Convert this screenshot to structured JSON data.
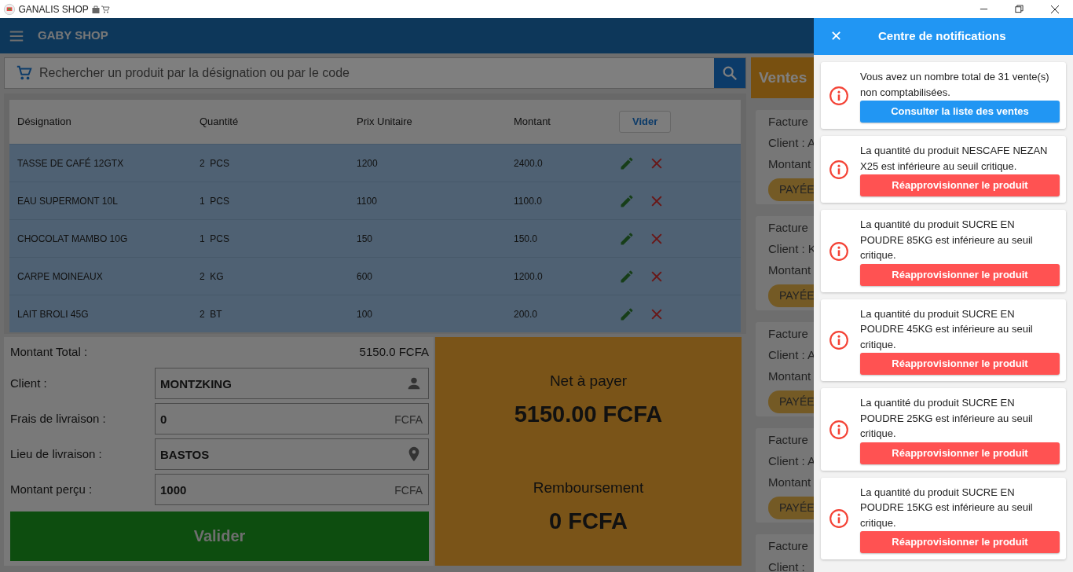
{
  "window": {
    "title": "GANALIS SHOP"
  },
  "app_bar": {
    "title": "GABY SHOP"
  },
  "search": {
    "placeholder": "Rechercher un produit par la désignation ou par le code"
  },
  "cart": {
    "columns": [
      "Désignation",
      "Quantité",
      "Prix Unitaire",
      "Montant"
    ],
    "clear_button": "Vider",
    "rows": [
      {
        "designation": "TASSE DE CAFÉ 12GTX",
        "quantity": "2",
        "unit": "PCS",
        "unit_price": "1200",
        "amount": "2400.0"
      },
      {
        "designation": "EAU SUPERMONT 10L",
        "quantity": "1",
        "unit": "PCS",
        "unit_price": "1100",
        "amount": "1100.0"
      },
      {
        "designation": "CHOCOLAT MAMBO 10G",
        "quantity": "1",
        "unit": "PCS",
        "unit_price": "150",
        "amount": "150.0"
      },
      {
        "designation": "CARPE MOINEAUX",
        "quantity": "2",
        "unit": "KG",
        "unit_price": "600",
        "amount": "1200.0"
      },
      {
        "designation": "LAIT BROLI 45G",
        "quantity": "2",
        "unit": "BT",
        "unit_price": "100",
        "amount": "200.0"
      }
    ]
  },
  "checkout": {
    "total_label": "Montant Total :",
    "total_value": "5150.0 FCFA",
    "fields": [
      {
        "kind": "person",
        "label": "Client :",
        "value": "MONTZKING"
      },
      {
        "kind": "currency",
        "label": "Frais de livraison :",
        "value": "0",
        "suffix": "FCFA"
      },
      {
        "kind": "place",
        "label": "Lieu de livraison :",
        "value": "BASTOS"
      },
      {
        "kind": "currency",
        "label": "Montant perçu :",
        "value": "1000",
        "suffix": "FCFA"
      }
    ],
    "submit_button": "Valider"
  },
  "payment": {
    "net_label": "Net à payer",
    "net_value": "5150.00 FCFA",
    "refund_label": "Remboursement",
    "refund_value": "0 FCFA"
  },
  "recent_sales": {
    "title": "Ventes",
    "cards": [
      {
        "invoice": "Facture",
        "client": "Client : A",
        "amount": "Montant",
        "status": "PAYÉE"
      },
      {
        "invoice": "Facture",
        "client": "Client : K",
        "amount": "Montant",
        "status": "PAYÉE"
      },
      {
        "invoice": "Facture",
        "client": "Client : A",
        "amount": "Montant",
        "status": "PAYÉE"
      },
      {
        "invoice": "Facture",
        "client": "Client : A",
        "amount": "Montant",
        "status": "PAYÉE"
      },
      {
        "invoice": "Facture",
        "client": "Client :"
      }
    ]
  },
  "notifications": {
    "title": "Centre de notifications",
    "close": "✕",
    "items": [
      {
        "kind": "sales",
        "message": "Vous avez un nombre total de 31 vente(s) non comptabilisées.",
        "action": "Consulter la liste des ventes"
      },
      {
        "kind": "stock",
        "message": "La quantité du produit NESCAFE NEZAN X25 est inférieure au seuil critique.",
        "action": "Réapprovisionner le produit"
      },
      {
        "kind": "stock",
        "message": "La quantité du produit SUCRE EN POUDRE 85KG est inférieure au seuil critique.",
        "action": "Réapprovisionner le produit"
      },
      {
        "kind": "stock",
        "message": "La quantité du produit SUCRE EN POUDRE 45KG est inférieure au seuil critique.",
        "action": "Réapprovisionner le produit"
      },
      {
        "kind": "stock",
        "message": "La quantité du produit SUCRE EN POUDRE 25KG est inférieure au seuil critique.",
        "action": "Réapprovisionner le produit"
      },
      {
        "kind": "stock",
        "message": "La quantité du produit SUCRE EN POUDRE 15KG est inférieure au seuil critique.",
        "action": "Réapprovisionner le produit"
      }
    ]
  }
}
